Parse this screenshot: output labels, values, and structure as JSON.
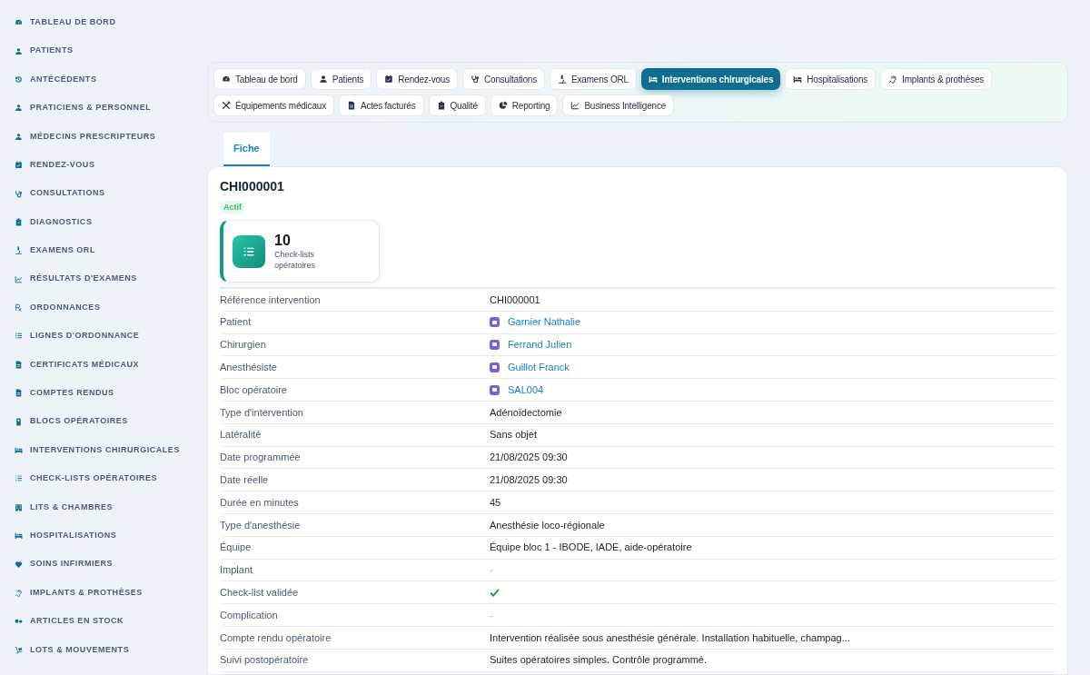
{
  "sidebar": {
    "items": [
      {
        "label": "TABLEAU DE BORD"
      },
      {
        "label": "PATIENTS"
      },
      {
        "label": "ANTÉCÉDENTS"
      },
      {
        "label": "PRATICIENS & PERSONNEL"
      },
      {
        "label": "MÉDECINS PRESCRIPTEURS"
      },
      {
        "label": "RENDEZ-VOUS"
      },
      {
        "label": "CONSULTATIONS"
      },
      {
        "label": "DIAGNOSTICS"
      },
      {
        "label": "EXAMENS ORL"
      },
      {
        "label": "RÉSULTATS D'EXAMENS"
      },
      {
        "label": "ORDONNANCES"
      },
      {
        "label": "LIGNES D'ORDONNANCE"
      },
      {
        "label": "CERTIFICATS MÉDICAUX"
      },
      {
        "label": "COMPTES RENDUS"
      },
      {
        "label": "BLOCS OPÉRATOIRES"
      },
      {
        "label": "INTERVENTIONS CHIRURGICALES"
      },
      {
        "label": "CHECK-LISTS OPÉRATOIRES"
      },
      {
        "label": "LITS & CHAMBRES"
      },
      {
        "label": "HOSPITALISATIONS"
      },
      {
        "label": "SOINS INFIRMIERS"
      },
      {
        "label": "IMPLANTS & PROTHÈSES"
      },
      {
        "label": "ARTICLES EN STOCK"
      },
      {
        "label": "LOTS & MOUVEMENTS"
      }
    ]
  },
  "module_tabs": [
    {
      "label": "Tableau de bord",
      "selected": false
    },
    {
      "label": "Patients",
      "selected": false
    },
    {
      "label": "Rendez-vous",
      "selected": false
    },
    {
      "label": "Consultations",
      "selected": false
    },
    {
      "label": "Examens ORL",
      "selected": false
    },
    {
      "label": "Interventions chirurgicales",
      "selected": true
    },
    {
      "label": "Hospitalisations",
      "selected": false
    },
    {
      "label": "Implants & prothèses",
      "selected": false
    },
    {
      "label": "Équipements médicaux",
      "selected": false
    },
    {
      "label": "Actes facturés",
      "selected": false
    },
    {
      "label": "Qualité",
      "selected": false
    },
    {
      "label": "Reporting",
      "selected": false
    },
    {
      "label": "Business Intelligence",
      "selected": false
    }
  ],
  "detail_tabs": [
    {
      "label": "Fiche",
      "selected": true
    }
  ],
  "record": {
    "title": "CHI000001",
    "status": "Actif",
    "stat": {
      "value": "10",
      "label": "Check-lists opératoires"
    },
    "fields": [
      {
        "label": "Référence intervention",
        "kind": "text",
        "value": "CHI000001"
      },
      {
        "label": "Patient",
        "kind": "link",
        "value": "Garnier Nathalie"
      },
      {
        "label": "Chirurgien",
        "kind": "link",
        "value": "Ferrand Julien"
      },
      {
        "label": "Anesthésiste",
        "kind": "link",
        "value": "Guillot Franck"
      },
      {
        "label": "Bloc opératoire",
        "kind": "link",
        "value": "SAL004"
      },
      {
        "label": "Type d'intervention",
        "kind": "text",
        "value": "Adénoïdectomie"
      },
      {
        "label": "Latéralité",
        "kind": "text",
        "value": "Sans objet"
      },
      {
        "label": "Date programmée",
        "kind": "text",
        "value": "21/08/2025 09:30"
      },
      {
        "label": "Date réelle",
        "kind": "text",
        "value": "21/08/2025 09:30"
      },
      {
        "label": "Durée en minutes",
        "kind": "text",
        "value": "45"
      },
      {
        "label": "Type d'anesthésie",
        "kind": "text",
        "value": "Anesthésie loco-régionale"
      },
      {
        "label": "Équipe",
        "kind": "text",
        "value": "Équipe bloc 1 - IBODE, IADE, aide-opératoire"
      },
      {
        "label": "Implant",
        "kind": "empty",
        "value": "-"
      },
      {
        "label": "Check-list validée",
        "kind": "check",
        "checked": true
      },
      {
        "label": "Complication",
        "kind": "empty",
        "value": "-"
      },
      {
        "label": "Compte rendu opératoire",
        "kind": "text",
        "value": "Intervention réalisée sous anesthésie générale. Installation habituelle, champag..."
      },
      {
        "label": "Suivi postopératoire",
        "kind": "text",
        "value": "Suites opératoires simples. Contrôle programmé."
      }
    ]
  }
}
